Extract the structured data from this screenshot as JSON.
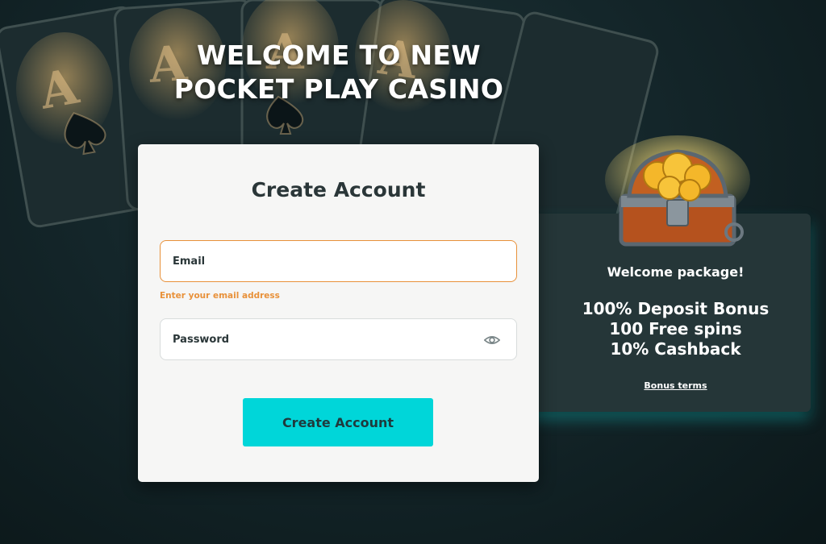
{
  "hero": {
    "title_line1": "WELCOME TO NEW",
    "title_line2": "POCKET PLAY CASINO"
  },
  "form": {
    "title": "Create Account",
    "email_placeholder": "Email",
    "email_helper": "Enter your email address",
    "password_placeholder": "Password",
    "submit_label": "Create Account"
  },
  "promo": {
    "heading": "Welcome package!",
    "offers": [
      "100% Deposit Bonus",
      "100 Free spins",
      "10% Cashback"
    ],
    "terms_link": "Bonus terms"
  },
  "colors": {
    "accent_cyan": "#00d6d9",
    "warning_orange": "#e8913a",
    "panel_dark": "#253638",
    "background": "#14262a"
  },
  "icons": {
    "password_toggle": "eye-icon",
    "promo_image": "treasure-chest-icon"
  }
}
